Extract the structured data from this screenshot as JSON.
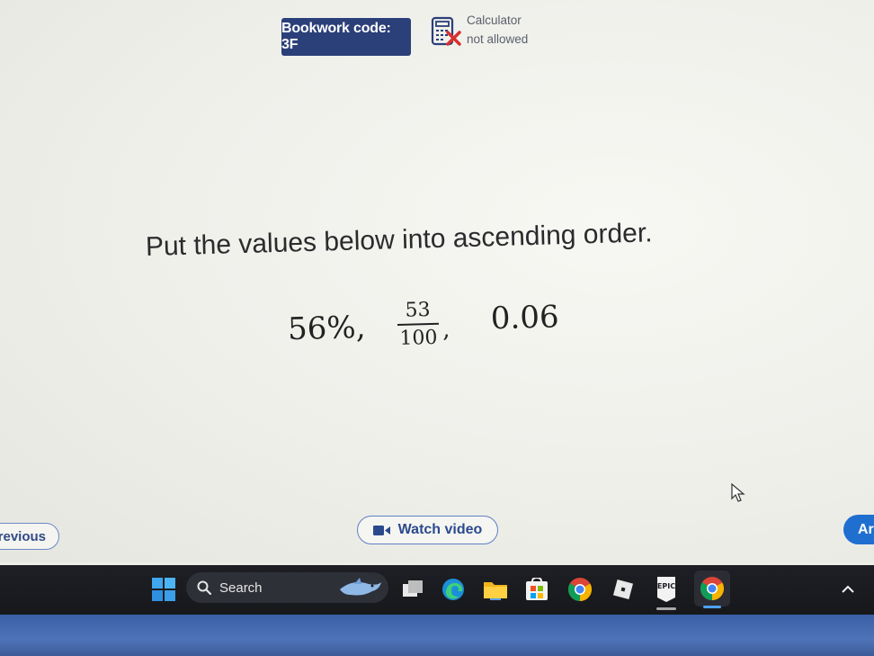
{
  "header": {
    "bookwork_code": "Bookwork code: 3F",
    "calculator_line1": "Calculator",
    "calculator_line2": "not allowed"
  },
  "question": {
    "prompt": "Put the values below into ascending order.",
    "value1": "56%,",
    "fraction_numerator": "53",
    "fraction_denominator": "100",
    "fraction_comma": ",",
    "value3": "0.06"
  },
  "footer": {
    "previous_label": "revious",
    "watch_video_label": "Watch video",
    "next_label": "Ar"
  },
  "taskbar": {
    "search_label": "Search",
    "epic_label": "EPIC"
  },
  "colors": {
    "bookwork_bg": "#2b3f79",
    "accent_blue": "#1f6fd0",
    "taskbar_bg": "#1e1f24"
  }
}
